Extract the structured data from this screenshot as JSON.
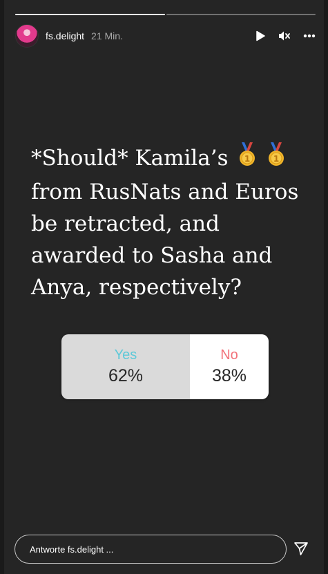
{
  "story": {
    "progress_segments": 2,
    "progress_filled": 1
  },
  "header": {
    "username": "fs.delight",
    "time": "21 Min.",
    "icons": [
      "play-icon",
      "mute-icon",
      "more-icon"
    ]
  },
  "question": {
    "text": "*Should* Kamila’s",
    "medals": [
      "gold-medal-icon",
      "gold-medal-icon"
    ],
    "text_rest": "from RusNats and Euros be retracted, and awarded to Sasha and Anya, respectively?"
  },
  "poll": {
    "options": [
      {
        "label": "Yes",
        "percent": "62%",
        "value": 62,
        "label_color": "#5ec9d8"
      },
      {
        "label": "No",
        "percent": "38%",
        "value": 38,
        "label_color": "#f2727a"
      }
    ]
  },
  "reply": {
    "placeholder": "Antworte fs.delight ..."
  },
  "colors": {
    "background": "#252525",
    "yes_fill": "#dadada",
    "no_fill": "#ffffff"
  }
}
